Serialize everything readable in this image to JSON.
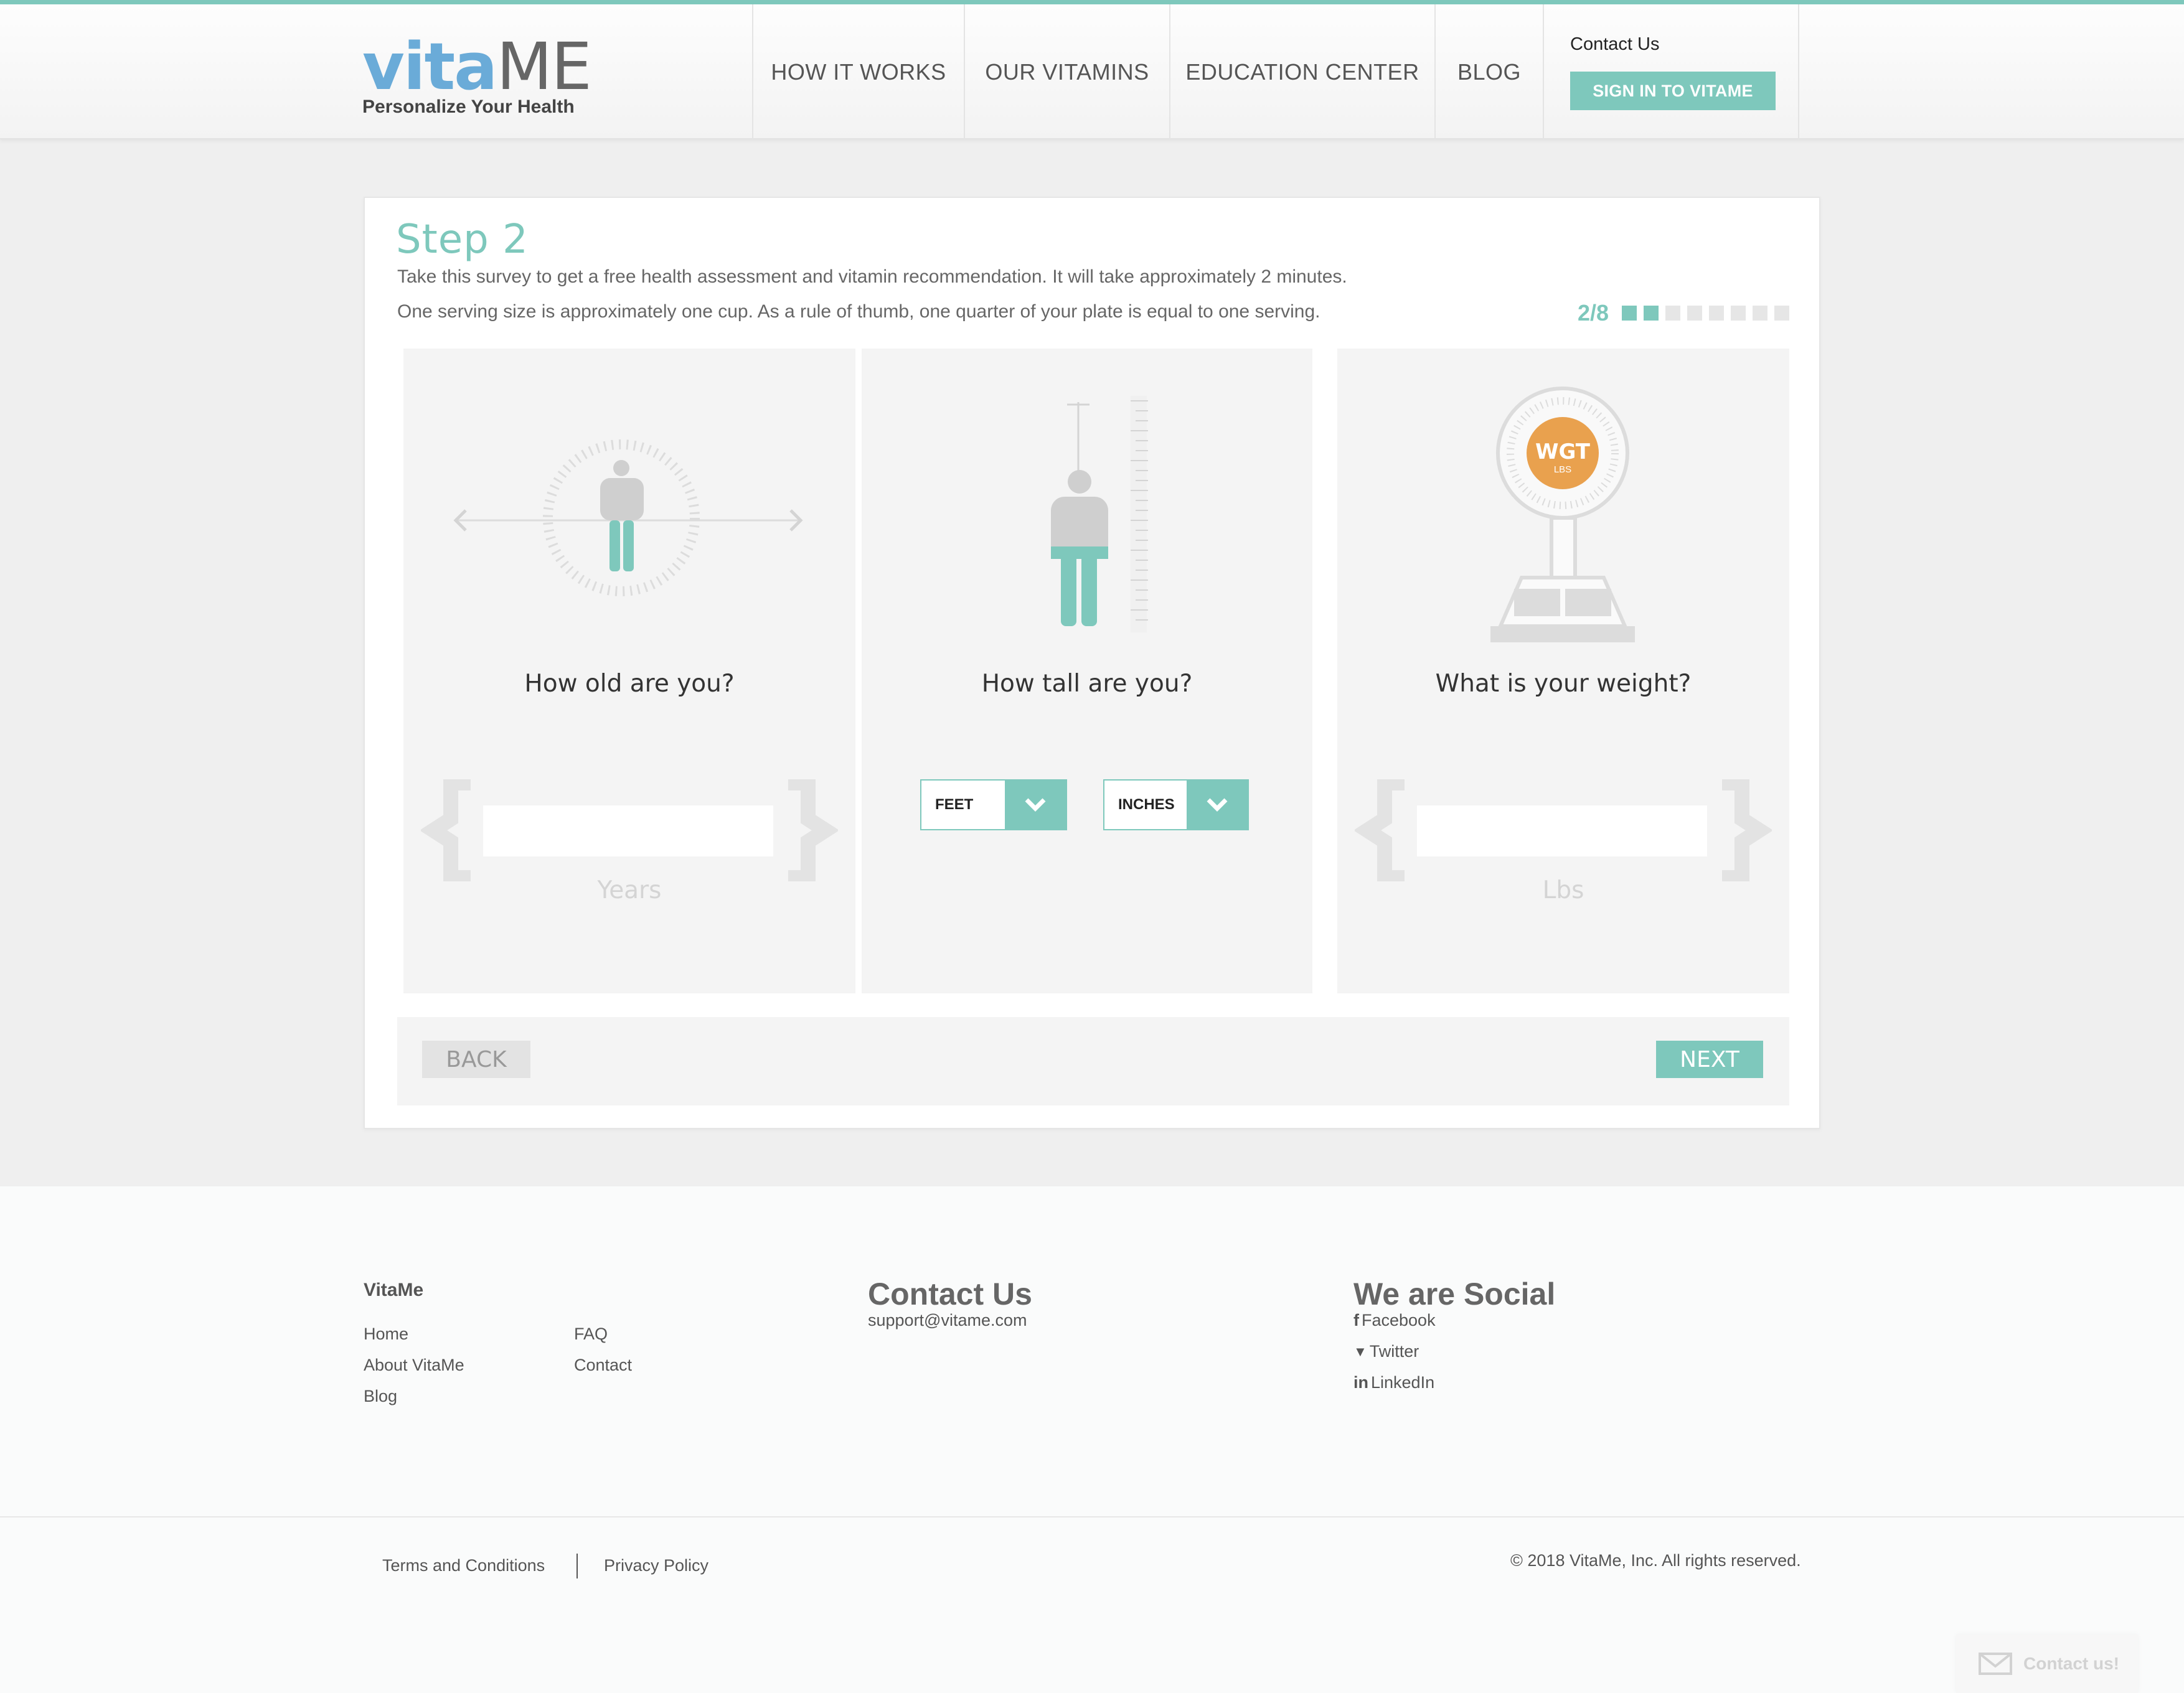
{
  "header": {
    "logo_vita": "vita",
    "logo_me": "ME",
    "tagline": "Personalize Your Health",
    "nav": [
      "HOW IT WORKS",
      "OUR VITAMINS",
      "EDUCATION CENTER",
      "BLOG"
    ],
    "contact_link": "Contact Us",
    "signin_label": "SIGN IN TO VITAME"
  },
  "survey": {
    "step_title": "Step 2",
    "intro_line1": "Take this survey to get a free health assessment and vitamin recommendation. It will take approximately 2 minutes.",
    "intro_line2": "One serving size is approximately one cup. As a rule of thumb, one quarter of your plate is equal to one serving.",
    "progress_text": "2/8",
    "progress_current": 2,
    "progress_total": 8,
    "age": {
      "question": "How old are you?",
      "value": "",
      "unit": "Years"
    },
    "height": {
      "question": "How tall are you?",
      "feet_label": "FEET",
      "inches_label": "INCHES"
    },
    "weight": {
      "question": "What is your weight?",
      "value": "",
      "unit": "Lbs",
      "scale_label": "WGT",
      "scale_sublabel": "LBS"
    },
    "back_label": "BACK",
    "next_label": "NEXT"
  },
  "footer": {
    "brand": "VitaMe",
    "links_col1": [
      "Home",
      "About VitaMe",
      "Blog"
    ],
    "links_col2": [
      "FAQ",
      "Contact"
    ],
    "contact_heading": "Contact Us",
    "contact_email": "support@vitame.com",
    "social_heading": "We are Social",
    "social": [
      {
        "icon": "facebook-icon",
        "glyph": "f",
        "label": "Facebook"
      },
      {
        "icon": "twitter-icon",
        "glyph": "🐦",
        "label": "Twitter"
      },
      {
        "icon": "linkedin-icon",
        "glyph": "in",
        "label": "LinkedIn"
      }
    ],
    "terms": "Terms and Conditions",
    "privacy": "Privacy Policy",
    "copyright": "© 2018 VitaMe, Inc. All rights reserved."
  },
  "widget": {
    "label": "Contact us!"
  },
  "colors": {
    "accent": "#7ec8bc",
    "logo_blue": "#6aabd8",
    "scale_orange": "#e9a14e"
  }
}
